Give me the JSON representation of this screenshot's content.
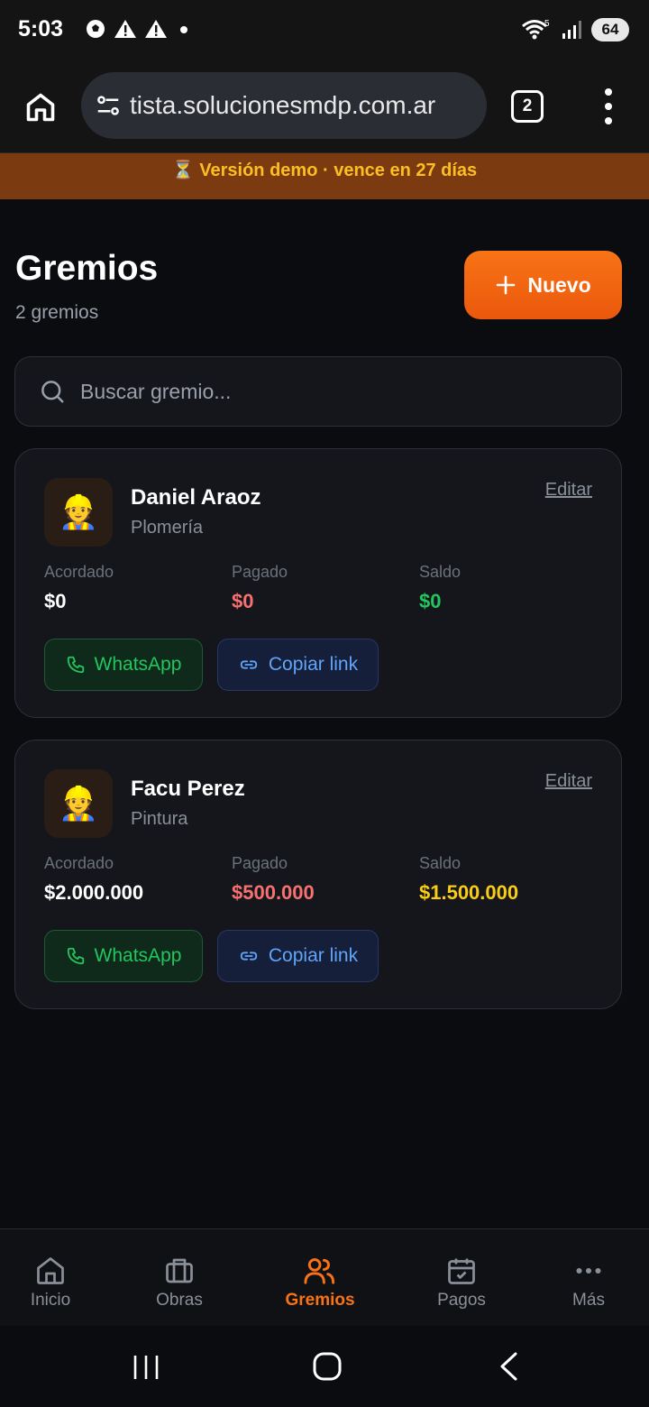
{
  "status_bar": {
    "time": "5:03",
    "battery": "64",
    "network_badge": "5"
  },
  "browser": {
    "url": "tista.solucionesmdp.com.ar",
    "tab_count": "2"
  },
  "banner": {
    "text": "⏳ Versión demo · vence en 27 días"
  },
  "header": {
    "title": "Gremios",
    "subtitle": "2 gremios",
    "new_button": "Nuevo"
  },
  "search": {
    "placeholder": "Buscar gremio..."
  },
  "cards": [
    {
      "avatar_emoji": "👷",
      "name": "Daniel Araoz",
      "trade": "Plomería",
      "edit_label": "Editar",
      "acordado_label": "Acordado",
      "acordado": "$0",
      "pagado_label": "Pagado",
      "pagado": "$0",
      "saldo_label": "Saldo",
      "saldo": "$0",
      "whatsapp_label": "WhatsApp",
      "copy_label": "Copiar link"
    },
    {
      "avatar_emoji": "👷",
      "name": "Facu Perez",
      "trade": "Pintura",
      "edit_label": "Editar",
      "acordado_label": "Acordado",
      "acordado": "$2.000.000",
      "pagado_label": "Pagado",
      "pagado": "$500.000",
      "saldo_label": "Saldo",
      "saldo": "$1.500.000",
      "whatsapp_label": "WhatsApp",
      "copy_label": "Copiar link"
    }
  ],
  "nav": [
    {
      "label": "Inicio",
      "icon": "home-icon"
    },
    {
      "label": "Obras",
      "icon": "briefcase-icon"
    },
    {
      "label": "Gremios",
      "icon": "users-icon",
      "active": true
    },
    {
      "label": "Pagos",
      "icon": "calendar-check-icon"
    },
    {
      "label": "Más",
      "icon": "more-icon"
    }
  ],
  "colors": {
    "accent": "#f97316",
    "pagado": "#f87171",
    "saldo_zero": "#22c55e",
    "saldo_pending": "#facc15",
    "banner_bg": "#7c3a11",
    "banner_text": "#fbbf24"
  }
}
